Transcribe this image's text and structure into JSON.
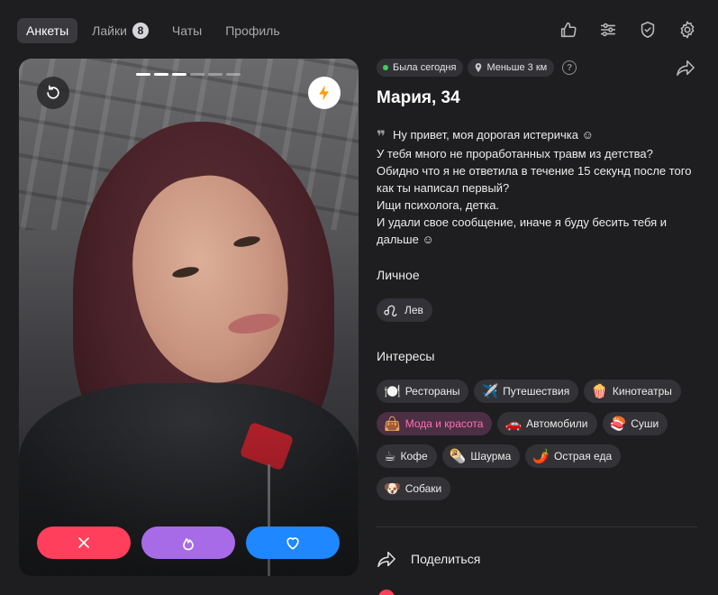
{
  "nav": {
    "tabs": [
      {
        "label": "Анкеты",
        "active": true
      },
      {
        "label": "Лайки",
        "badge": "8"
      },
      {
        "label": "Чаты"
      },
      {
        "label": "Профиль"
      }
    ],
    "icons": [
      "thumbs-up-icon",
      "filters-icon",
      "shield-check-icon",
      "gear-icon"
    ]
  },
  "photo": {
    "progress_total": 6,
    "progress_current": 3,
    "undo_icon": "undo-icon",
    "boost_icon": "lightning-icon",
    "boost_color": "#ff9f0a"
  },
  "actions": {
    "dislike_icon": "close-icon",
    "superlike_icon": "flame-icon",
    "like_icon": "heart-icon",
    "dislike_color": "#ff3f5b",
    "superlike_color": "#a86be8",
    "like_color": "#1f87ff"
  },
  "profile": {
    "status": "Была сегодня",
    "status_color": "#3ccf5a",
    "distance": "Меньше 3 км",
    "help": "?",
    "name": "Мария, 34",
    "bio_quote": "❞",
    "bio_lines": [
      "Ну привет, моя дорогая истеричка ☺",
      "У тебя много не проработанных травм из детства?",
      "Обидно что я не ответила в течение 15 секунд после того",
      "как ты написал первый?",
      "Ищи психолога, детка.",
      "И удали свое сообщение, иначе я буду бесить тебя и",
      "дальше ☺"
    ]
  },
  "personal": {
    "title": "Личное",
    "tags": [
      {
        "icon": "leo-zodiac-icon",
        "label": "Лев"
      }
    ]
  },
  "interests": {
    "title": "Интересы",
    "rows": [
      [
        {
          "emoji": "🍽️",
          "label": "Рестораны"
        },
        {
          "emoji": "✈️",
          "label": "Путешествия"
        },
        {
          "emoji": "🍿",
          "label": "Кинотеатры"
        }
      ],
      [
        {
          "emoji": "👜",
          "label": "Мода и красота",
          "highlight": true
        },
        {
          "emoji": "🚗",
          "label": "Автомобили"
        },
        {
          "emoji": "🍣",
          "label": "Суши"
        }
      ],
      [
        {
          "emoji": "☕",
          "label": "Кофе"
        },
        {
          "emoji": "🌯",
          "label": "Шаурма"
        },
        {
          "emoji": "🌶️",
          "label": "Острая еда"
        }
      ],
      [
        {
          "emoji": "🐶",
          "label": "Собаки"
        }
      ]
    ],
    "highlight_color": "#ff6fb8"
  },
  "footer": {
    "share_label": "Поделиться",
    "share_icon": "share-arrow-icon"
  }
}
